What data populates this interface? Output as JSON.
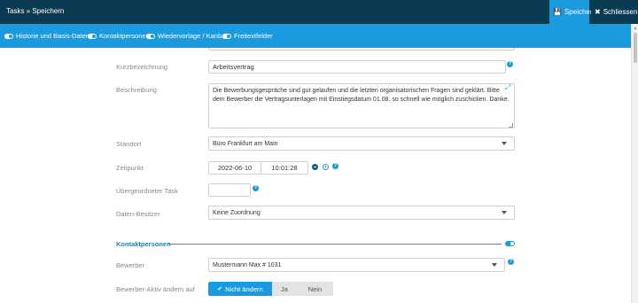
{
  "header": {
    "title": "Tasks » Speichern",
    "save_label": "Speichern",
    "close_label": "Schliessen"
  },
  "tabs": [
    {
      "label": "Historie und Basis-Daten"
    },
    {
      "label": "Kontaktpersonen"
    },
    {
      "label": "Wiedervorlage / Kanban"
    },
    {
      "label": "Freitextfelder"
    }
  ],
  "form": {
    "kurzbezeichnung": {
      "label": "Kurzbezeichnung",
      "value": "Arbeitsvertrag"
    },
    "beschreibung": {
      "label": "Beschreibung",
      "value": "Die Bewerbungsgespräche sind gut gelaufen und die letzten organisatorischen Fragen sind geklärt. Bitte dem Bewerber die Vertragsunterlagen mit Einstiegsdatum 01.08. so schnell wie möglich zuschicken. Danke."
    },
    "standort": {
      "label": "Standort",
      "value": "Büro Frankfurt am Main"
    },
    "zeitpunkt": {
      "label": "Zeitpunkt",
      "date": "2022-06-10",
      "time": "10:01:28"
    },
    "uebergeordneter_task": {
      "label": "Übergeordneter Task",
      "value": ""
    },
    "daten_besitzer": {
      "label": "Daten-Besitzer",
      "value": "Keine Zuordnung"
    }
  },
  "kontakt": {
    "section_title": "Kontaktpersonen",
    "bewerber": {
      "label": "Bewerber",
      "value": "Mustermann Max # 1031"
    },
    "bewerber_aktiv": {
      "label": "Bewerber-Aktiv ändern auf",
      "options": [
        "Nicht ändern",
        "Ja",
        "Nein"
      ],
      "selected": "Nicht ändern"
    }
  },
  "help_glyph": "?",
  "colors": {
    "header_bg": "#0b3b52",
    "accent": "#1a9be0",
    "section_title": "#1a7fc2"
  }
}
